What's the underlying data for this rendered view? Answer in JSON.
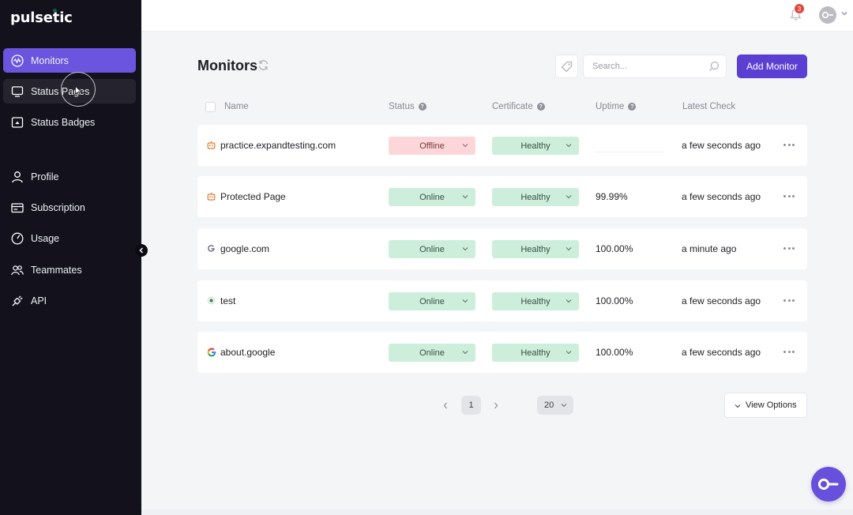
{
  "app": {
    "logo": "pulsetic"
  },
  "sidebar": {
    "items": [
      {
        "label": "Monitors",
        "icon": "monitor-pulse-icon"
      },
      {
        "label": "Status Pages",
        "icon": "screen-icon"
      },
      {
        "label": "Status Badges",
        "icon": "badge-icon"
      },
      {
        "label": "Profile",
        "icon": "user-icon"
      },
      {
        "label": "Subscription",
        "icon": "card-icon"
      },
      {
        "label": "Usage",
        "icon": "gauge-icon"
      },
      {
        "label": "Teammates",
        "icon": "users-icon"
      },
      {
        "label": "API",
        "icon": "plug-icon"
      }
    ]
  },
  "topbar": {
    "notification_count": "3"
  },
  "main": {
    "title": "Monitors",
    "search_placeholder": "Search...",
    "add_button": "Add Monitor",
    "columns": {
      "name": "Name",
      "status": "Status",
      "certificate": "Certificate",
      "uptime": "Uptime",
      "latest_check": "Latest Check"
    },
    "help_glyph": "?",
    "rows": [
      {
        "name": "practice.expandtesting.com",
        "icon": "robot-icon",
        "status": "Offline",
        "certificate": "Healthy",
        "uptime": "",
        "latest": "a few seconds ago"
      },
      {
        "name": "Protected Page",
        "icon": "robot-icon",
        "status": "Online",
        "certificate": "Healthy",
        "uptime": "99.99%",
        "latest": "a few seconds ago"
      },
      {
        "name": "google.com",
        "icon": "google-g-small-icon",
        "status": "Online",
        "certificate": "Healthy",
        "uptime": "100.00%",
        "latest": "a minute ago"
      },
      {
        "name": "test",
        "icon": "dot-icon",
        "status": "Online",
        "certificate": "Healthy",
        "uptime": "100.00%",
        "latest": "a few seconds ago"
      },
      {
        "name": "about.google",
        "icon": "google-g-icon",
        "status": "Online",
        "certificate": "Healthy",
        "uptime": "100.00%",
        "latest": "a few seconds ago"
      }
    ]
  },
  "pagination": {
    "current": "1",
    "page_size": "20",
    "view_options": "View Options"
  },
  "colors": {
    "accent": "#6b54de",
    "button": "#5a3fd2",
    "online_bg": "#cdeedb",
    "offline_bg": "#fcd6d8",
    "sidebar_bg": "#13121c"
  }
}
